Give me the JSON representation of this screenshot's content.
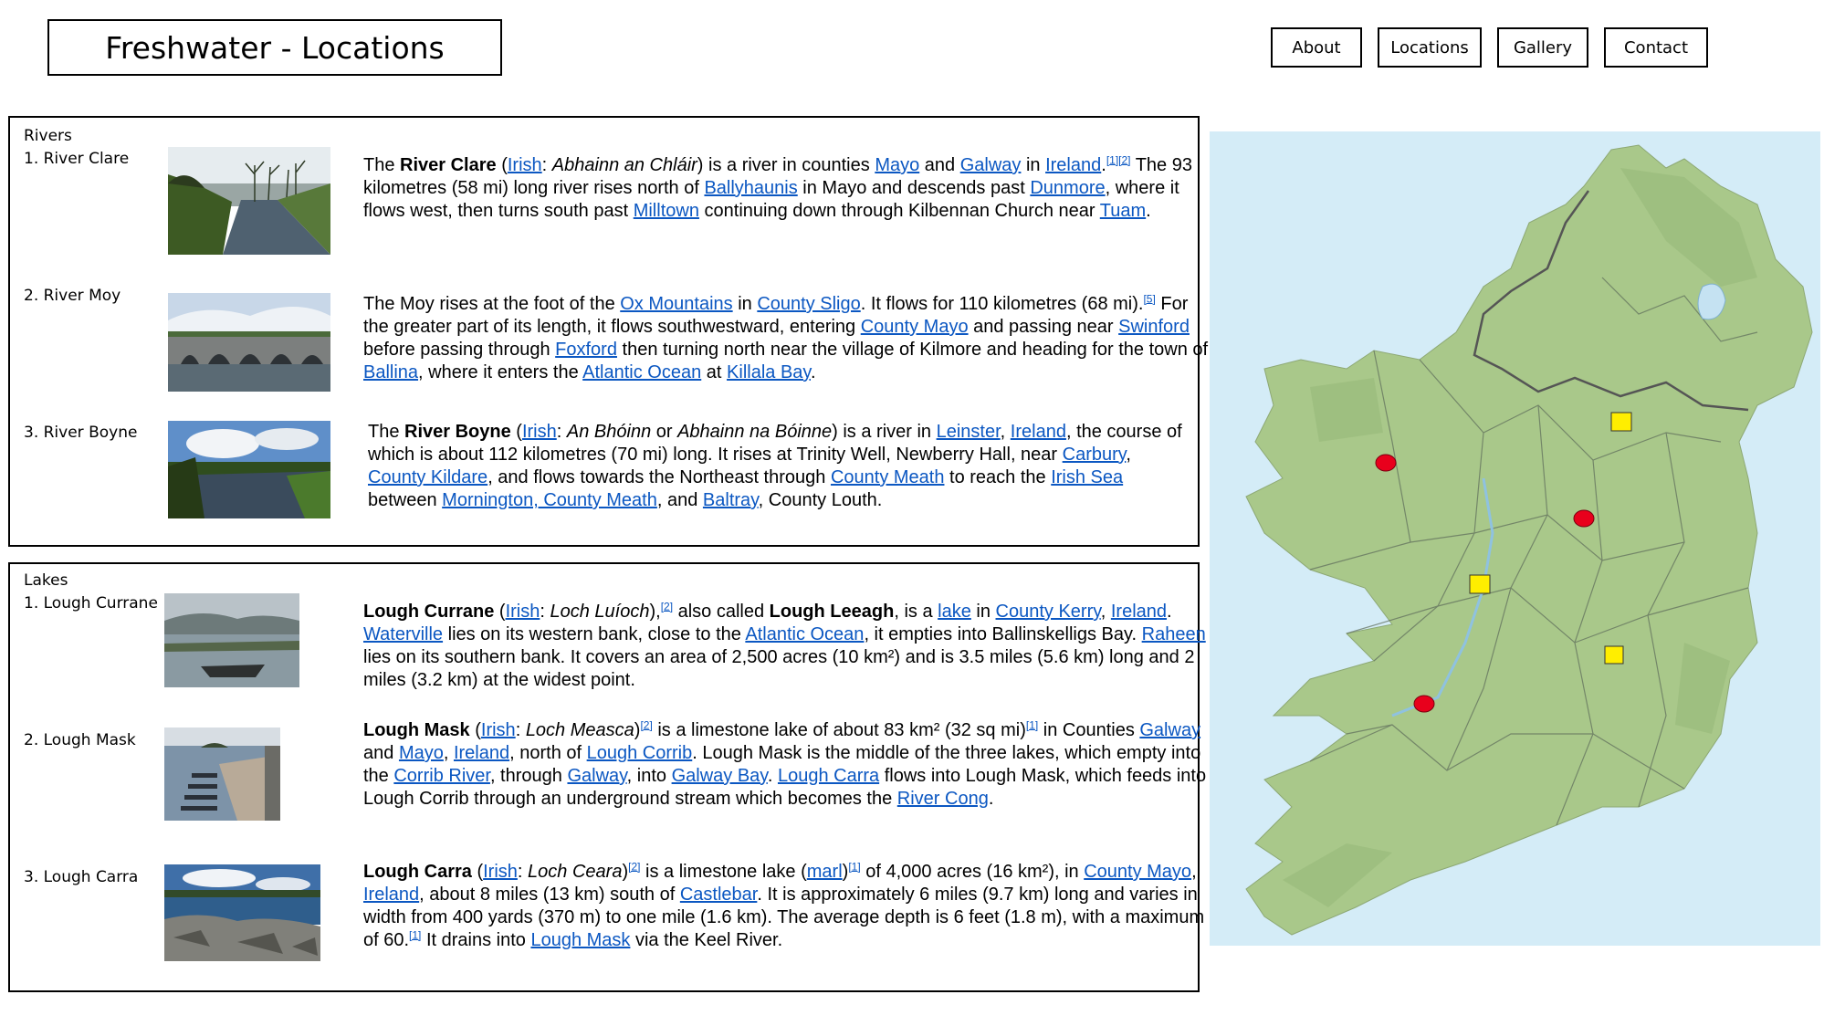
{
  "header": {
    "title": "Freshwater - Locations"
  },
  "nav": [
    "About",
    "Locations",
    "Gallery",
    "Contact"
  ],
  "rivers": {
    "heading": "Rivers",
    "items": [
      {
        "label": "1. River Clare",
        "segments": [
          {
            "t": "The "
          },
          {
            "t": "River Clare",
            "b": true
          },
          {
            "t": " ("
          },
          {
            "t": "Irish",
            "link": true
          },
          {
            "t": ": "
          },
          {
            "t": "Abhainn an Chláir",
            "i": true
          },
          {
            "t": ") is a river in counties "
          },
          {
            "t": "Mayo",
            "link": true
          },
          {
            "t": " and "
          },
          {
            "t": "Galway",
            "link": true
          },
          {
            "t": " in "
          },
          {
            "t": "Ireland",
            "link": true
          },
          {
            "t": "."
          },
          {
            "t": "[1][2]",
            "sup": true
          },
          {
            "t": " The 93 kilometres (58 mi) long river rises north of "
          },
          {
            "t": "Ballyhaunis",
            "link": true
          },
          {
            "t": " in Mayo and descends past "
          },
          {
            "t": "Dunmore",
            "link": true
          },
          {
            "t": ", where it flows west, then turns south past "
          },
          {
            "t": "Milltown",
            "link": true
          },
          {
            "t": " continuing down through Kilbennan Church near "
          },
          {
            "t": "Tuam",
            "link": true
          },
          {
            "t": "."
          }
        ]
      },
      {
        "label": "2. River Moy",
        "segments": [
          {
            "t": "The Moy rises at the foot of the "
          },
          {
            "t": "Ox Mountains",
            "link": true
          },
          {
            "t": " in "
          },
          {
            "t": "County Sligo",
            "link": true
          },
          {
            "t": ". It flows for 110 kilometres (68 mi)."
          },
          {
            "t": "[5]",
            "sup": true
          },
          {
            "t": " For the greater part of its length, it flows southwestward, entering "
          },
          {
            "t": "County Mayo",
            "link": true
          },
          {
            "t": " and passing near "
          },
          {
            "t": "Swinford",
            "link": true
          },
          {
            "t": " before passing through "
          },
          {
            "t": "Foxford",
            "link": true
          },
          {
            "t": " then turning north near the village of Kilmore and heading for the town of "
          },
          {
            "t": "Ballina",
            "link": true
          },
          {
            "t": ", where it enters the "
          },
          {
            "t": "Atlantic Ocean",
            "link": true
          },
          {
            "t": " at "
          },
          {
            "t": "Killala Bay",
            "link": true
          },
          {
            "t": "."
          }
        ]
      },
      {
        "label": "3. River Boyne",
        "segments": [
          {
            "t": "The "
          },
          {
            "t": "River Boyne",
            "b": true
          },
          {
            "t": " ("
          },
          {
            "t": "Irish",
            "link": true
          },
          {
            "t": ": "
          },
          {
            "t": "An Bhóinn",
            "i": true
          },
          {
            "t": " or "
          },
          {
            "t": "Abhainn na Bóinne",
            "i": true
          },
          {
            "t": ") is a river in "
          },
          {
            "t": "Leinster",
            "link": true
          },
          {
            "t": ", "
          },
          {
            "t": "Ireland",
            "link": true
          },
          {
            "t": ", the course of which is about 112 kilometres (70 mi) long. It rises at Trinity Well, Newberry Hall, near "
          },
          {
            "t": "Carbury",
            "link": true
          },
          {
            "t": ", "
          },
          {
            "t": "County Kildare",
            "link": true
          },
          {
            "t": ", and flows towards the Northeast through "
          },
          {
            "t": "County Meath",
            "link": true
          },
          {
            "t": " to reach the "
          },
          {
            "t": "Irish Sea",
            "link": true
          },
          {
            "t": " between "
          },
          {
            "t": "Mornington, County Meath",
            "link": true
          },
          {
            "t": ", and "
          },
          {
            "t": "Baltray",
            "link": true
          },
          {
            "t": ", County Louth."
          }
        ]
      }
    ]
  },
  "lakes": {
    "heading": "Lakes",
    "items": [
      {
        "label": "1. Lough Currane",
        "segments": [
          {
            "t": "Lough Currane",
            "b": true
          },
          {
            "t": " ("
          },
          {
            "t": "Irish",
            "link": true
          },
          {
            "t": ": "
          },
          {
            "t": "Loch Luíoch",
            "i": true
          },
          {
            "t": "),"
          },
          {
            "t": "[2]",
            "sup": true
          },
          {
            "t": " also called "
          },
          {
            "t": "Lough Leeagh",
            "b": true
          },
          {
            "t": ", is a "
          },
          {
            "t": "lake",
            "link": true
          },
          {
            "t": " in "
          },
          {
            "t": "County Kerry",
            "link": true
          },
          {
            "t": ", "
          },
          {
            "t": "Ireland",
            "link": true
          },
          {
            "t": ". "
          },
          {
            "t": "Waterville",
            "link": true
          },
          {
            "t": " lies on its western bank, close to the "
          },
          {
            "t": "Atlantic Ocean",
            "link": true
          },
          {
            "t": ", it empties into Ballinskelligs Bay. "
          },
          {
            "t": "Raheen",
            "link": true
          },
          {
            "t": " lies on its southern bank. It covers an area of 2,500 acres (10 km²) and is 3.5 miles (5.6 km) long and 2 miles (3.2 km) at the widest point."
          }
        ]
      },
      {
        "label": "2. Lough Mask",
        "segments": [
          {
            "t": "Lough Mask",
            "b": true
          },
          {
            "t": " ("
          },
          {
            "t": "Irish",
            "link": true
          },
          {
            "t": ": "
          },
          {
            "t": "Loch Measca",
            "i": true
          },
          {
            "t": ")"
          },
          {
            "t": "[2]",
            "sup": true
          },
          {
            "t": " is a limestone lake of about 83 km² (32 sq mi)"
          },
          {
            "t": "[1]",
            "sup": true
          },
          {
            "t": " in Counties "
          },
          {
            "t": "Galway",
            "link": true
          },
          {
            "t": " and "
          },
          {
            "t": "Mayo",
            "link": true
          },
          {
            "t": ", "
          },
          {
            "t": "Ireland",
            "link": true
          },
          {
            "t": ", north of "
          },
          {
            "t": "Lough Corrib",
            "link": true
          },
          {
            "t": ". Lough Mask is the middle of the three lakes, which empty into the "
          },
          {
            "t": "Corrib River",
            "link": true
          },
          {
            "t": ", through "
          },
          {
            "t": "Galway",
            "link": true
          },
          {
            "t": ", into "
          },
          {
            "t": "Galway Bay",
            "link": true
          },
          {
            "t": ". "
          },
          {
            "t": "Lough Carra",
            "link": true
          },
          {
            "t": " flows into Lough Mask, which feeds into Lough Corrib through an underground stream which becomes the "
          },
          {
            "t": "River Cong",
            "link": true
          },
          {
            "t": "."
          }
        ]
      },
      {
        "label": "3. Lough Carra",
        "segments": [
          {
            "t": "Lough Carra",
            "b": true
          },
          {
            "t": " ("
          },
          {
            "t": "Irish",
            "link": true
          },
          {
            "t": ": "
          },
          {
            "t": "Loch Ceara",
            "i": true
          },
          {
            "t": ")"
          },
          {
            "t": "[2]",
            "sup": true
          },
          {
            "t": " is a limestone lake ("
          },
          {
            "t": "marl",
            "link": true
          },
          {
            "t": ")"
          },
          {
            "t": "[1]",
            "sup": true
          },
          {
            "t": " of 4,000 acres (16 km²), in "
          },
          {
            "t": "County Mayo",
            "link": true
          },
          {
            "t": ", "
          },
          {
            "t": "Ireland",
            "link": true
          },
          {
            "t": ", about 8 miles (13 km) south of "
          },
          {
            "t": "Castlebar",
            "link": true
          },
          {
            "t": ". It is approximately 6 miles (9.7 km) long and varies in width from 400 yards (370 m) to one mile (1.6 km). The average depth is 6 feet (1.8 m), with a maximum of 60."
          },
          {
            "t": "[1]",
            "sup": true
          },
          {
            "t": " It drains into "
          },
          {
            "t": "Lough Mask",
            "link": true
          },
          {
            "t": " via the Keel River."
          }
        ]
      }
    ]
  },
  "map": {
    "sea_color": "#d4ecf7",
    "land_color": "#a9c88a",
    "river_marker_color": "#e8001c",
    "lake_marker_color": "#ffee00"
  }
}
